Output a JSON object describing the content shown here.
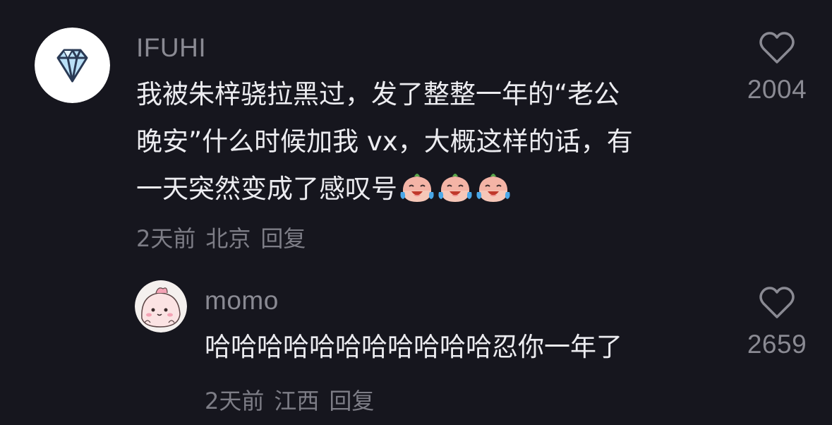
{
  "comments": [
    {
      "avatar_icon": "diamond-icon",
      "username": "IFUHI",
      "text_lines": [
        "我被朱梓骁拉黑过，发了整整一年的“老公",
        "晚安”什么时候加我 vx，大概这样的话，有",
        "一天突然变成了感叹号"
      ],
      "emojis": [
        "crying-laughing-peach-emoji",
        "crying-laughing-peach-emoji",
        "crying-laughing-peach-emoji"
      ],
      "time": "2天前",
      "location": "北京",
      "reply_label": "回复",
      "like_icon": "heart-icon",
      "like_count": "2004"
    },
    {
      "avatar_icon": "pink-cartoon-avatar",
      "username": "momo",
      "text": "哈哈哈哈哈哈哈哈哈哈哈忍你一年了",
      "time": "2天前",
      "location": "江西",
      "reply_label": "回复",
      "like_icon": "heart-icon",
      "like_count": "2659"
    }
  ],
  "colors": {
    "background": "#16161e",
    "username": "#8a8a93",
    "text": "#ececf0",
    "meta": "#7d7d86"
  }
}
